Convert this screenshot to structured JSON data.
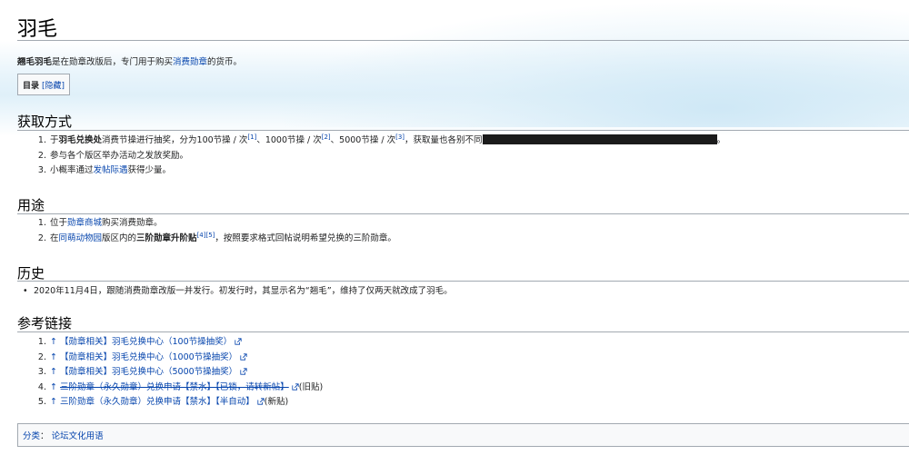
{
  "title": "羽毛",
  "lead": {
    "bold": "翘毛羽毛",
    "text1": "是在勋章改版后，专门用于购买",
    "link": "消费勋章",
    "text2": "的货币。"
  },
  "toc": {
    "label": "目录",
    "toggle": "[隐藏]"
  },
  "sections": {
    "acquire": {
      "heading": "获取方式",
      "items": [
        {
          "num": "1.",
          "p1": "于",
          "bold": "羽毛兑换处",
          "p2": "消费节操进行抽奖，分为100节操 / 次",
          "r1": "[1]",
          "p3": "、1000节操 / 次",
          "r2": "[2]",
          "p4": "、5000节操 / 次",
          "r3": "[3]",
          "p5": "，获取量也各别不同",
          "p6": "。"
        },
        {
          "num": "2.",
          "text": "参与各个版区举办活动之发放奖励。"
        },
        {
          "num": "3.",
          "p1": "小概率通过",
          "link": "发帖际遇",
          "p2": "获得少量。"
        }
      ]
    },
    "usage": {
      "heading": "用途",
      "items": [
        {
          "num": "1.",
          "p1": "位于",
          "link": "勋章商城",
          "p2": "购买消费勋章。"
        },
        {
          "num": "2.",
          "p1": "在",
          "link": "同萌动物园",
          "p2": "版区内的",
          "bold": "三阶勋章升阶贴",
          "r1": "[4]",
          "r2": "[5]",
          "p3": "，按照要求格式回帖说明希望兑换的三阶勋章。"
        }
      ]
    },
    "history": {
      "heading": "历史",
      "items": [
        {
          "text": "2020年11月4日，跟随消费勋章改版一并发行。初发行时，其显示名为“翘毛”，维持了仅两天就改成了羽毛。"
        }
      ]
    },
    "refs": {
      "heading": "参考链接",
      "items": [
        {
          "num": "1.",
          "arrow": "↑",
          "link": "【勋章相关】羽毛兑换中心（100节操抽奖）",
          "suffix": ""
        },
        {
          "num": "2.",
          "arrow": "↑",
          "link": "【勋章相关】羽毛兑换中心（1000节操抽奖）",
          "suffix": ""
        },
        {
          "num": "3.",
          "arrow": "↑",
          "link": "【勋章相关】羽毛兑换中心（5000节操抽奖）",
          "suffix": ""
        },
        {
          "num": "4.",
          "arrow": "↑",
          "link": "三阶勋章（永久勋章）兑换申请【禁水】【已锁，请转新帖】",
          "suffix": "(旧贴)"
        },
        {
          "num": "5.",
          "arrow": "↑",
          "link": "三阶勋章（永久勋章）兑换申请【禁水】【半自动】",
          "suffix": "(新贴)"
        }
      ]
    }
  },
  "categories": {
    "label": "分类",
    "sep": "：",
    "link": "论坛文化用语"
  },
  "colors": {
    "link": "#0645ad",
    "border": "#a2a9b1",
    "box_bg": "#f8f9fa"
  },
  "icons": {
    "external": "external-link-icon"
  }
}
